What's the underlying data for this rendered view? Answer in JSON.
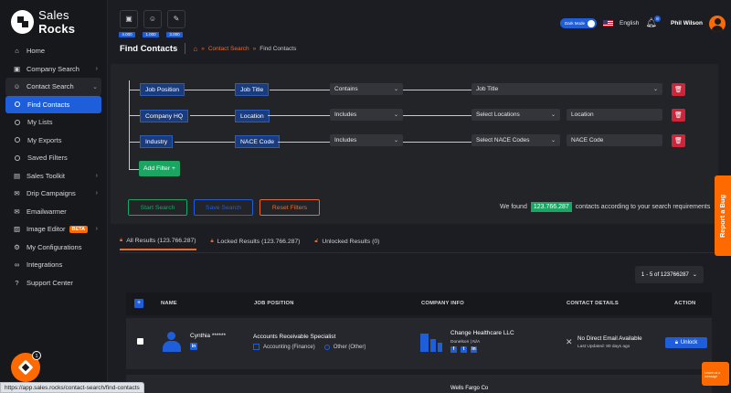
{
  "app": {
    "brand_light": "Sales ",
    "brand_bold": "Rocks"
  },
  "sidebar": {
    "items": [
      {
        "label": "Home",
        "icon": "home-icon"
      },
      {
        "label": "Company Search",
        "icon": "briefcase-icon"
      },
      {
        "label": "Contact Search",
        "icon": "user-icon"
      },
      {
        "label": "Sales Toolkit",
        "icon": "toolbox-icon"
      },
      {
        "label": "Drip Campaigns",
        "icon": "mail-icon"
      },
      {
        "label": "Emailwarmer",
        "icon": "email-icon"
      },
      {
        "label": "Image Editor",
        "icon": "image-icon",
        "badge": "BETA"
      },
      {
        "label": "My Configurations",
        "icon": "gear-icon"
      },
      {
        "label": "Integrations",
        "icon": "link-icon"
      },
      {
        "label": "Support Center",
        "icon": "help-icon"
      }
    ],
    "sub": [
      {
        "label": "Find Contacts"
      },
      {
        "label": "My Lists"
      },
      {
        "label": "My Exports"
      },
      {
        "label": "Saved Filters"
      }
    ]
  },
  "topbar": {
    "credits": [
      {
        "icon": "briefcase-icon",
        "value": "4.000"
      },
      {
        "icon": "users-icon",
        "value": "1.000"
      },
      {
        "icon": "wrench-icon",
        "value": "3.000"
      }
    ],
    "dark_mode_label": "Dark Mode",
    "language": "English",
    "notifications": "8",
    "user_name": "Phil Wilson"
  },
  "header": {
    "title": "Find Contacts",
    "breadcrumb": [
      "Contact Search",
      "Find Contacts"
    ]
  },
  "filters": {
    "rows": [
      {
        "group": "Job Position",
        "field": "Job Title",
        "operator": "Contains",
        "value_select": "Job Title",
        "value_input": ""
      },
      {
        "group": "Company HQ",
        "field": "Location",
        "operator": "Includes",
        "value_select": "Select Locations",
        "value_input": "Location"
      },
      {
        "group": "Industry",
        "field": "NACE Code",
        "operator": "Includes",
        "value_select": "Select NACE Codes",
        "value_input": "NACE Code"
      }
    ],
    "add_filter_label": "Add Filter +",
    "start_label": "Start Search",
    "save_label": "Save Search",
    "reset_label": "Reset Filters",
    "found_prefix": "We found",
    "found_count": "123.766.287",
    "found_suffix": "contacts according to your search requirements"
  },
  "tabs": [
    {
      "label": "All Results (123.766.287)"
    },
    {
      "label": "Locked Results (123.766.287)"
    },
    {
      "label": "Unlocked Results (0)"
    }
  ],
  "pager": {
    "label": "1 - 5 of 123766287"
  },
  "table": {
    "columns": [
      "NAME",
      "JOB POSITION",
      "COMPANY INFO",
      "CONTACT DETAILS",
      "ACTION"
    ],
    "rows": [
      {
        "name": "Cynthia ******",
        "job": "Accounts Receivable Specialist",
        "department": "Accounting (Finance)",
        "level": "Other (Other)",
        "company": "Change Healthcare LLC",
        "company_sub": "Donelson | N/A",
        "contact": "No Direct Email Available",
        "updated": "Last Updated: 80 days ago",
        "action": "Unlock"
      },
      {
        "company": "Wells Fargo Co"
      }
    ]
  },
  "report_bug": "Report a Bug",
  "chat": {
    "line1": "Leave us a",
    "line2": "message"
  },
  "fab_count": "1",
  "status_url": "https://app.sales.rocks/contact-search/find-contacts",
  "colors": {
    "accent": "#1f5edb",
    "brand": "#ff6a00",
    "success": "#1aa563",
    "danger": "#d0243a"
  }
}
